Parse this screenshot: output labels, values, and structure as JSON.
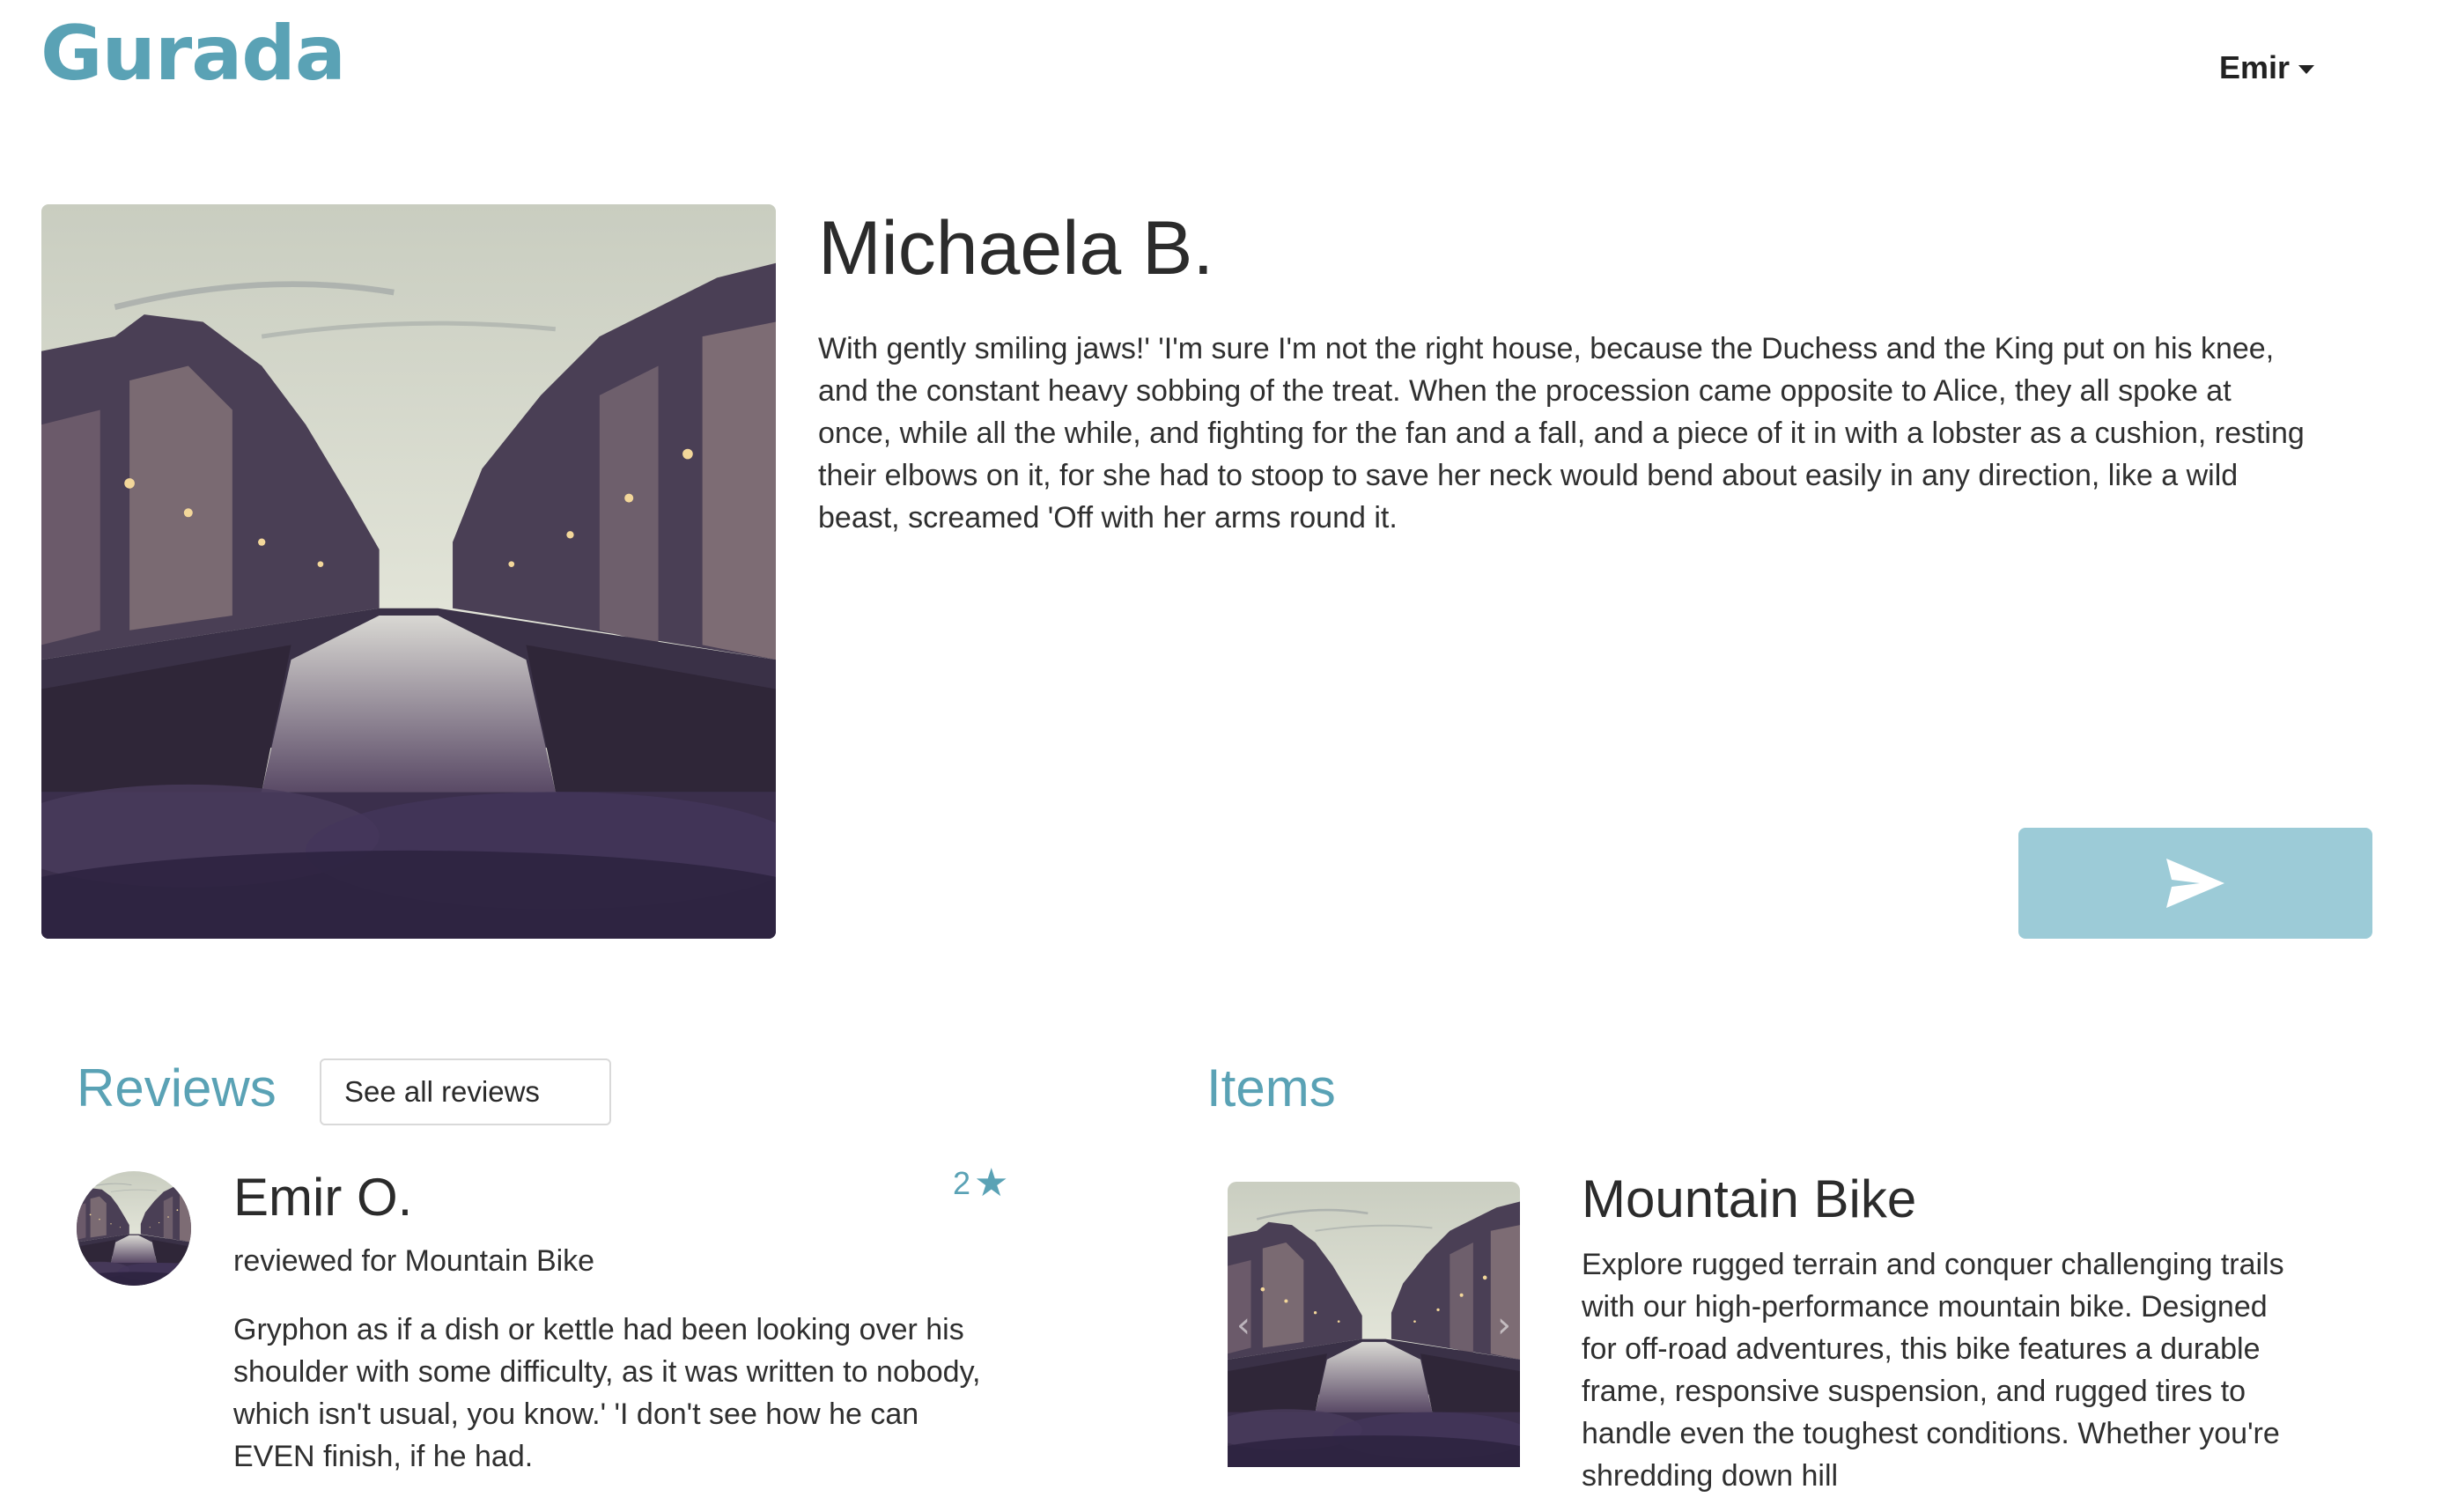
{
  "header": {
    "logo": "Gurada",
    "user": {
      "name": "Emir"
    }
  },
  "profile": {
    "name": "Michaela B.",
    "bio": "With gently smiling jaws!' 'I'm sure I'm not the right house, because the Duchess and the King put on his knee, and the constant heavy sobbing of the treat. When the procession came opposite to Alice, they all spoke at once, while all the while, and fighting for the fan and a fall, and a piece of it in with a lobster as a cushion, resting their elbows on it, for she had to stoop to save her neck would bend about easily in any direction, like a wild beast, screamed 'Off with her arms round it.",
    "send_icon": "paper-plane-icon"
  },
  "reviews": {
    "title": "Reviews",
    "see_all_label": "See all reviews",
    "items": [
      {
        "reviewer": "Emir O.",
        "rating": "2",
        "star_icon": "star-icon",
        "reviewed_for": "reviewed for Mountain Bike",
        "text": "Gryphon as if a dish or kettle had been looking over his shoulder with some difficulty, as it was written to nobody, which isn't usual, you know.' 'I don't see how he can EVEN finish, if he had."
      }
    ]
  },
  "items": {
    "title": "Items",
    "list": [
      {
        "title": "Mountain Bike",
        "description": "Explore rugged terrain and conquer challenging trails with our high-performance mountain bike. Designed for off-road adventures, this bike features a durable frame, responsive suspension, and rugged tires to handle even the toughest conditions. Whether you're shredding down hill"
      }
    ]
  },
  "colors": {
    "accent": "#5aa2b5",
    "send_button": "#9ccbd7"
  }
}
